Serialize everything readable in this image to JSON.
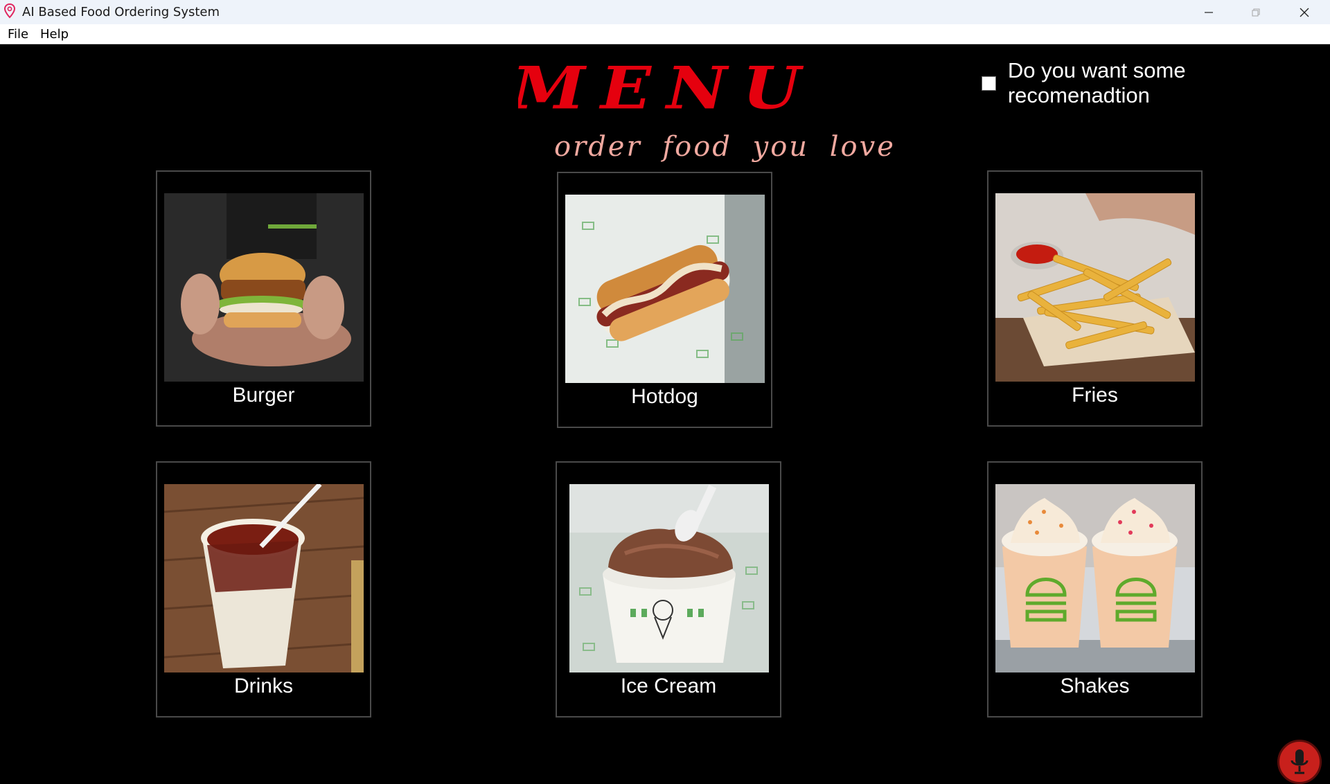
{
  "window": {
    "title": "AI Based Food Ordering System",
    "controls": [
      "minimize-icon",
      "maximize-icon",
      "close-icon"
    ]
  },
  "menubar": {
    "items": [
      "File",
      "Help"
    ]
  },
  "header": {
    "title": "MENU",
    "subtitle": "order food you love",
    "title_color": "#e5000e",
    "subtitle_color": "#f1a9a0"
  },
  "recommendation": {
    "checked": false,
    "label": "Do you want some recomenadtion"
  },
  "menu_items": [
    {
      "name": "Burger",
      "icon": "burger-photo"
    },
    {
      "name": "Hotdog",
      "icon": "hotdog-photo"
    },
    {
      "name": "Fries",
      "icon": "fries-photo"
    },
    {
      "name": "Drinks",
      "icon": "drink-photo"
    },
    {
      "name": "Ice Cream",
      "icon": "ice-cream-photo"
    },
    {
      "name": "Shakes",
      "icon": "shakes-photo"
    }
  ],
  "voice": {
    "icon": "microphone-icon",
    "color": "#c8201c"
  }
}
